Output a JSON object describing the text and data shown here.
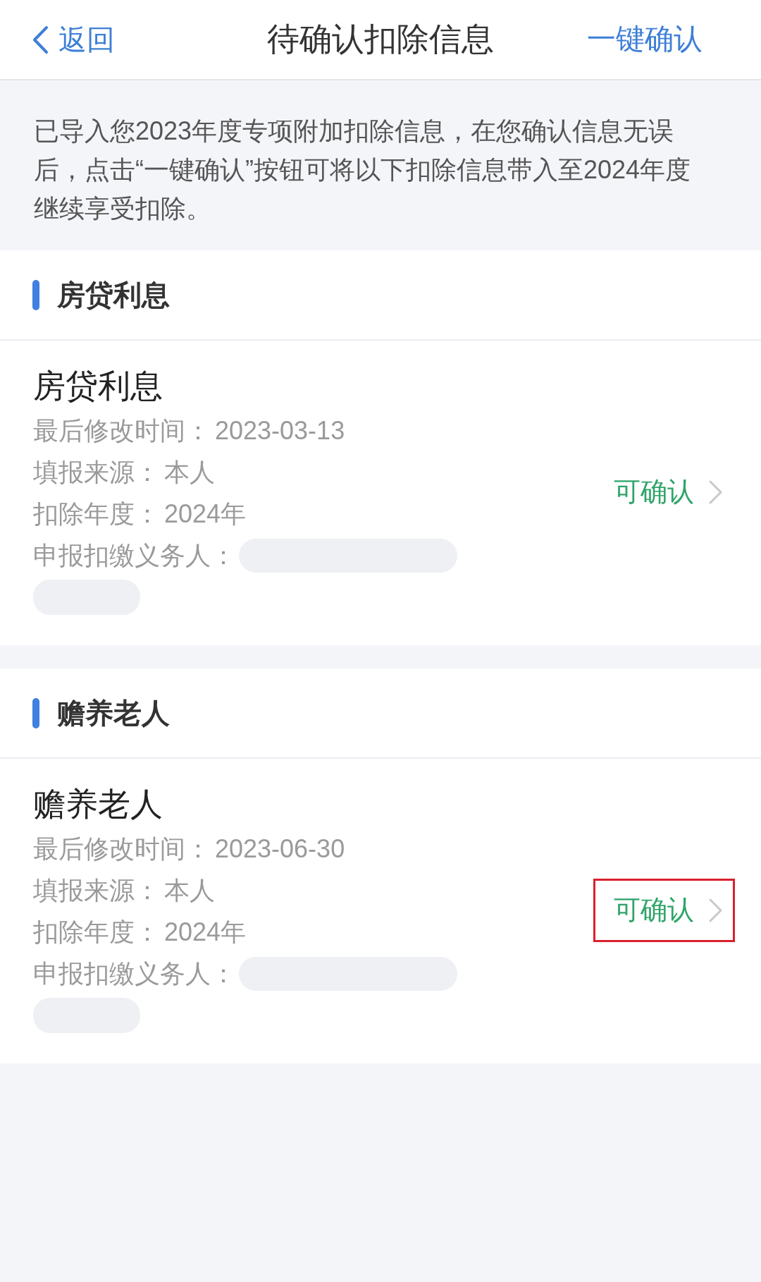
{
  "nav_bar": {
    "back": "返回",
    "title": "待确认扣除信息",
    "action": "一键确认"
  },
  "notice": "已导入您2023年度专项附加扣除信息，在您确认信息无误后，点击“一键确认”按钮可将以下扣除信息带入至2024年度继续享受扣除。",
  "sections": [
    {
      "heading": "房贷利息",
      "items": [
        {
          "title": "房贷利息",
          "fields": [
            {
              "label": "最后修改时间：",
              "value": "2023-03-13",
              "redacted": false
            },
            {
              "label": "填报来源：",
              "value": "本人",
              "redacted": false
            },
            {
              "label": "扣除年度：",
              "value": "2024年",
              "redacted": false
            },
            {
              "label": "申报扣缴义务人：",
              "redacted": true
            }
          ],
          "status": "可确认",
          "highlighted": false
        }
      ]
    },
    {
      "heading": "赡养老人",
      "items": [
        {
          "title": "赡养老人",
          "fields": [
            {
              "label": "最后修改时间：",
              "value": "2023-06-30",
              "redacted": false
            },
            {
              "label": "填报来源：",
              "value": "本人",
              "redacted": false
            },
            {
              "label": "扣除年度：",
              "value": "2024年",
              "redacted": false
            },
            {
              "label": "申报扣缴义务人：",
              "redacted": true
            }
          ],
          "status": "可确认",
          "highlighted": true
        }
      ]
    }
  ]
}
